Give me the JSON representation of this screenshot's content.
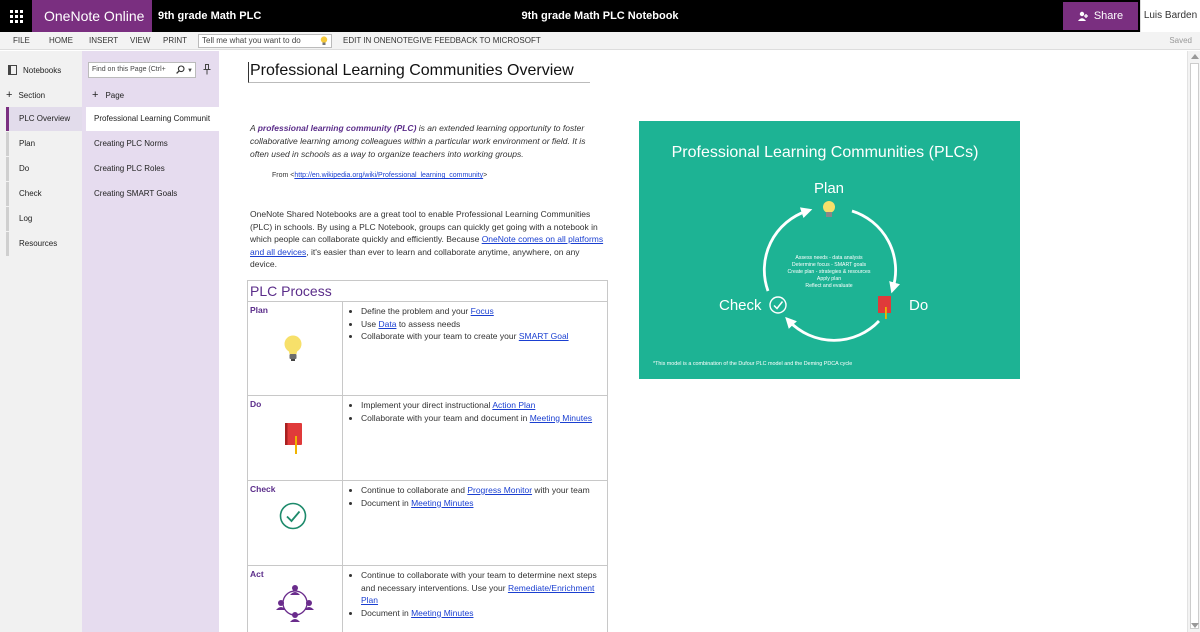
{
  "app": {
    "brand": "OneNote Online",
    "notebook_breadcrumb": "9th grade Math PLC",
    "center_title": "9th grade Math PLC Notebook",
    "share_label": "Share",
    "user_name": "Luis Barden"
  },
  "ribbon": {
    "tabs": [
      "FILE",
      "HOME",
      "INSERT",
      "VIEW",
      "PRINT"
    ],
    "tell_me_placeholder": "Tell me what you want to do",
    "edit_in_onenote": "EDIT IN ONENOTE",
    "feedback": "GIVE FEEDBACK TO MICROSOFT",
    "status": "Saved"
  },
  "sections_pane": {
    "notebooks_label": "Notebooks",
    "add_section_label": "Section",
    "items": [
      "PLC Overview",
      "Plan",
      "Do",
      "Check",
      "Log",
      "Resources"
    ]
  },
  "pages_pane": {
    "find_placeholder": "Find on this Page (Ctrl+",
    "add_page_label": "Page",
    "items": [
      "Professional Learning Communit",
      "Creating PLC Norms",
      "Creating PLC Roles",
      "Creating SMART Goals"
    ]
  },
  "page": {
    "title": "Professional Learning Communities Overview",
    "definition": {
      "prefix": "A ",
      "bold": "professional learning community (PLC)",
      "rest": " is an extended learning opportunity to foster collaborative learning among colleagues within a particular work environment or field. It is often used in schools as a way to organize teachers into working groups."
    },
    "from_label": "From <",
    "from_link": "http://en.wikipedia.org/wiki/Professional_learning_community",
    "from_close": ">",
    "intro_before": "OneNote Shared Notebooks are a great tool to enable Professional Learning Communities (PLC) in schools.  By using a PLC Notebook, groups can quickly get going with a notebook in which people can collaborate quickly and efficiently.  Because ",
    "intro_link": "OneNote comes on all platforms and all devices",
    "intro_after": ", it's easier than ever to learn and collaborate anytime, anywhere, on any device.",
    "table_header": "PLC Process",
    "steps": {
      "plan": {
        "label": "Plan",
        "b1_pre": "Define the problem and your ",
        "b1_link": "Focus",
        "b2_pre": "Use ",
        "b2_link": "Data",
        "b2_post": " to assess needs",
        "b3_pre": "Collaborate with your team to create your ",
        "b3_link": "SMART Goal"
      },
      "do": {
        "label": "Do",
        "b1_pre": "Implement your direct instructional ",
        "b1_link": "Action Plan",
        "b2_pre": "Collaborate with your team and document in ",
        "b2_link": "Meeting Minutes"
      },
      "check": {
        "label": "Check",
        "b1_pre": "Continue to collaborate and ",
        "b1_link": "Progress Monitor",
        "b1_post": " with your team",
        "b2_pre": "Document in ",
        "b2_link": "Meeting Minutes"
      },
      "act": {
        "label": "Act",
        "b1_pre": "Continue to collaborate with your team to determine next steps and necessary interventions. Use your ",
        "b1_link": "Remediate/Enrichment Plan",
        "b2_pre": "Document in ",
        "b2_link": "Meeting Minutes"
      }
    }
  },
  "graphic": {
    "title": "Professional Learning Communities (PLCs)",
    "plan": "Plan",
    "do": "Do",
    "check": "Check",
    "center_lines": [
      "Assess needs - data analysis",
      "Determine focus - SMART goals",
      "Create plan - strategies & resources",
      "Apply plan",
      "Reflect and evaluate"
    ],
    "footnote": "*This model is a combination of the Dufour PLC model and the Deming PDCA cycle"
  },
  "colors": {
    "brand_purple": "#7a2f80",
    "graphic_green": "#1db394",
    "link_blue": "#1a3fd1",
    "heading_purple": "#5b2d8a"
  },
  "icons": [
    "waffle-icon",
    "share-person-icon",
    "lightbulb-icon",
    "notebooks-icon",
    "plus-icon",
    "search-icon",
    "pin-icon",
    "notebook-icon",
    "checkmark-icon",
    "collaboration-icon"
  ]
}
